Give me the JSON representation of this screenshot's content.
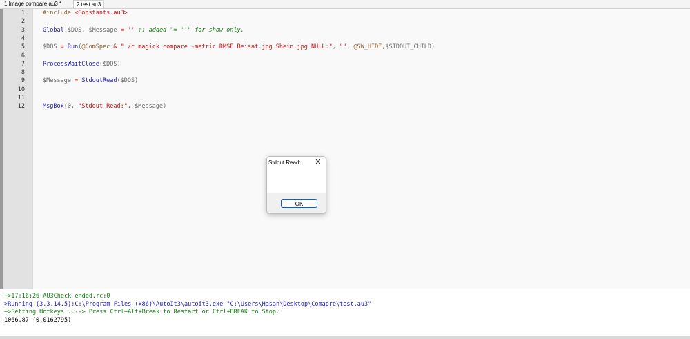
{
  "tabs": [
    {
      "label": "1 Image compare.au3 *",
      "active": false
    },
    {
      "label": "2 test.au3",
      "active": true
    }
  ],
  "editor": {
    "lines": [
      {
        "num": "1",
        "segments": [
          {
            "t": "#include ",
            "c": "pp"
          },
          {
            "t": "<Constants.au3>",
            "c": "str"
          }
        ]
      },
      {
        "num": "2",
        "segments": []
      },
      {
        "num": "3",
        "segments": [
          {
            "t": "Global ",
            "c": "kw"
          },
          {
            "t": "$DOS",
            "c": "var"
          },
          {
            "t": ", ",
            "c": "var"
          },
          {
            "t": "$Message",
            "c": "var"
          },
          {
            "t": " = ",
            "c": "op"
          },
          {
            "t": "'' ",
            "c": "str"
          },
          {
            "t": ";; added \"= ''\" for show only.",
            "c": "cm"
          }
        ]
      },
      {
        "num": "4",
        "segments": []
      },
      {
        "num": "5",
        "segments": [
          {
            "t": "$DOS",
            "c": "var"
          },
          {
            "t": " = ",
            "c": "op"
          },
          {
            "t": "Run",
            "c": "kw"
          },
          {
            "t": "(",
            "c": "var"
          },
          {
            "t": "@ComSpec",
            "c": "mac"
          },
          {
            "t": " & ",
            "c": "op"
          },
          {
            "t": "\" /c magick compare -metric RMSE Beisat.jpg Shein.jpg NULL:\"",
            "c": "str"
          },
          {
            "t": ", ",
            "c": "var"
          },
          {
            "t": "\"\"",
            "c": "str"
          },
          {
            "t": ", ",
            "c": "var"
          },
          {
            "t": "@SW_HIDE",
            "c": "mac"
          },
          {
            "t": ",",
            "c": "var"
          },
          {
            "t": "$STDOUT_CHILD",
            "c": "var"
          },
          {
            "t": ")",
            "c": "var"
          }
        ]
      },
      {
        "num": "6",
        "segments": []
      },
      {
        "num": "7",
        "segments": [
          {
            "t": "ProcessWaitClose",
            "c": "kw"
          },
          {
            "t": "(",
            "c": "var"
          },
          {
            "t": "$DOS",
            "c": "var"
          },
          {
            "t": ")",
            "c": "var"
          }
        ]
      },
      {
        "num": "8",
        "segments": []
      },
      {
        "num": "9",
        "segments": [
          {
            "t": "$Message",
            "c": "var"
          },
          {
            "t": " = ",
            "c": "op"
          },
          {
            "t": "StdoutRead",
            "c": "kw"
          },
          {
            "t": "(",
            "c": "var"
          },
          {
            "t": "$DOS",
            "c": "var"
          },
          {
            "t": ")",
            "c": "var"
          }
        ]
      },
      {
        "num": "10",
        "segments": []
      },
      {
        "num": "11",
        "segments": []
      },
      {
        "num": "12",
        "segments": [
          {
            "t": "MsgBox",
            "c": "kw"
          },
          {
            "t": "(0, ",
            "c": "var"
          },
          {
            "t": "\"Stdout Read:\"",
            "c": "str"
          },
          {
            "t": ", ",
            "c": "var"
          },
          {
            "t": "$Message",
            "c": "var"
          },
          {
            "t": ")",
            "c": "var"
          }
        ]
      }
    ]
  },
  "dialog": {
    "title": "Stdout Read:",
    "close_glyph": "✕",
    "ok_label": "OK"
  },
  "output": {
    "lines": [
      {
        "text": "+>17:16:26 AU3Check ended.rc:0",
        "c": "green"
      },
      {
        "text": ">Running:(3.3.14.5):C:\\Program Files (x86)\\AutoIt3\\autoit3.exe \"C:\\Users\\Hasan\\Desktop\\Comapre\\test.au3\"",
        "c": "blue"
      },
      {
        "text": "+>Setting Hotkeys...--> Press Ctrl+Alt+Break to Restart or Ctrl+BREAK to Stop.",
        "c": "green"
      },
      {
        "text": "1066.87 (0.0162795)",
        "c": "black"
      }
    ]
  }
}
